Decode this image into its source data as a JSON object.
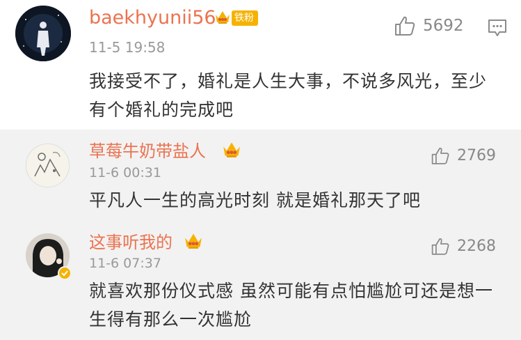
{
  "comments": [
    {
      "username": "baekhyunii56",
      "badge": "铁粉",
      "timestamp": "11-5 19:58",
      "text": "我接受不了，婚礼是人生大事，不说多风光，至少有个婚礼的完成吧",
      "likes": "5692",
      "icons": [
        "crown-icon",
        "thumbs-up-icon",
        "reply-icon"
      ]
    },
    {
      "username": "草莓牛奶带盐人",
      "timestamp": "11-6 00:31",
      "text": "平凡人一生的高光时刻 就是婚礼那天了吧",
      "likes": "2769",
      "icons": [
        "crown-icon",
        "thumbs-up-icon"
      ]
    },
    {
      "username": "这事听我的",
      "timestamp": "11-6 07:37",
      "text": "就喜欢那份仪式感 虽然可能有点怕尴尬可还是想一生得有那么一次尴尬",
      "likes": "2268",
      "icons": [
        "crown-icon",
        "verified-icon",
        "thumbs-up-icon"
      ]
    }
  ],
  "colors": {
    "username": "#eb7350",
    "timestamp": "#999999",
    "body_text": "#333333",
    "badge_gold": "#f6b200",
    "sub_background": "#f2f2f2"
  }
}
